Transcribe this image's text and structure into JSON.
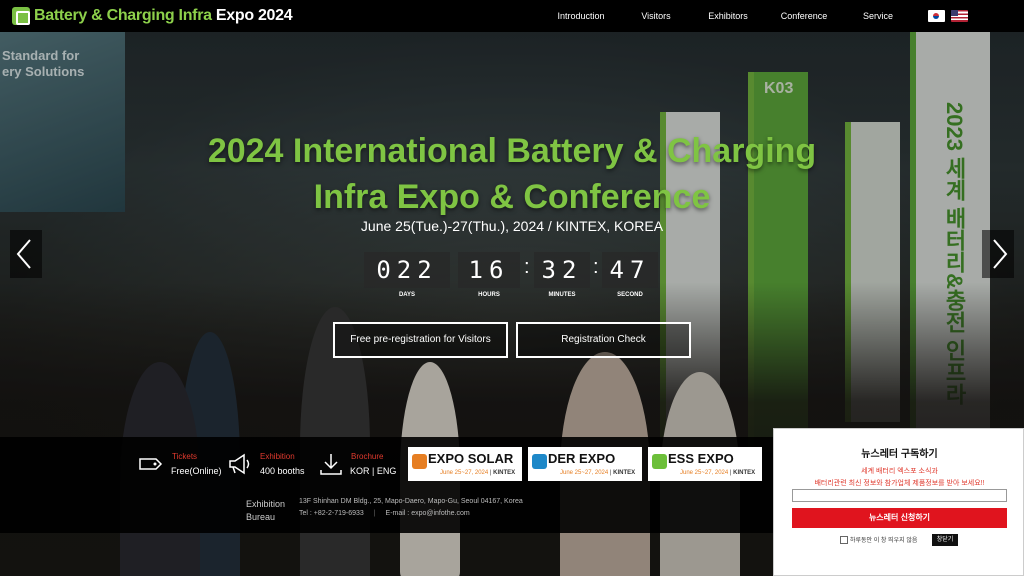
{
  "header": {
    "logo_part1": "Battery & Charging Infra",
    "logo_part2": "Expo 2024",
    "nav": [
      {
        "label": "Introduction"
      },
      {
        "label": "Visitors"
      },
      {
        "label": "Exhibitors"
      },
      {
        "label": "Conference"
      },
      {
        "label": "Service"
      }
    ]
  },
  "background": {
    "board_text_line1": "Standard for",
    "board_text_line2": "ery Solutions",
    "booth_k03": "K03",
    "banner_text": "2023 세계 배터리&충전 인프라"
  },
  "hero": {
    "title_line1": "2024 International Battery & Charging",
    "title_line2": "Infra Expo & Conference",
    "subtitle": "June 25(Tue.)-27(Thu.), 2024 / KINTEX, KOREA"
  },
  "countdown": {
    "days": "022",
    "hours": "16",
    "minutes": "32",
    "seconds": "47",
    "days_label": "DAYS",
    "hours_label": "HOURS",
    "minutes_label": "MINUTES",
    "seconds_label": "SECOND"
  },
  "cta": {
    "preregistration": "Free pre-registration for Visitors",
    "registration_check": "Registration Check"
  },
  "info": {
    "tickets_label": "Tickets",
    "tickets_value": "Free(Online)",
    "exhibition_label": "Exhibition",
    "exhibition_value": "400 booths",
    "brochure_label": "Brochure",
    "brochure_value": "KOR | ENG"
  },
  "banners": [
    {
      "name": "EXPO SOLAR",
      "date": "June 25~27, 2024",
      "venue": "KINTEX",
      "color": "#e67e22"
    },
    {
      "name": "DER EXPO",
      "date": "June 25~27, 2024",
      "venue": "KINTEX",
      "color": "#1e88c8"
    },
    {
      "name": "ESS EXPO",
      "date": "June 25~27, 2024",
      "venue": "KINTEX",
      "color": "#6cbf3a"
    }
  ],
  "footer": {
    "bureau_line1": "Exhibition",
    "bureau_line2": "Bureau",
    "address": "13F Shinhan DM Bldg., 25, Mapo-Daero, Mapo-Gu, Seoul 04167, Korea",
    "tel": "Tel : +82-2-719-6933",
    "email": "E-mail : expo@infothe.com"
  },
  "newsletter": {
    "title": "뉴스레터 구독하기",
    "text1": "세계 배터리 엑스포 소식과",
    "text2": "배터리관련 최신 정보와 참가업체 제품정보를 받아 보세요!!",
    "input_placeholder": "",
    "submit": "뉴스레터 신청하기",
    "dont_show": "하루동안 이 창 띄우지 않음",
    "close": "창닫기"
  },
  "colors": {
    "accent_green": "#7fc443",
    "accent_red": "#e03a2e",
    "popup_button": "#e0141e"
  }
}
